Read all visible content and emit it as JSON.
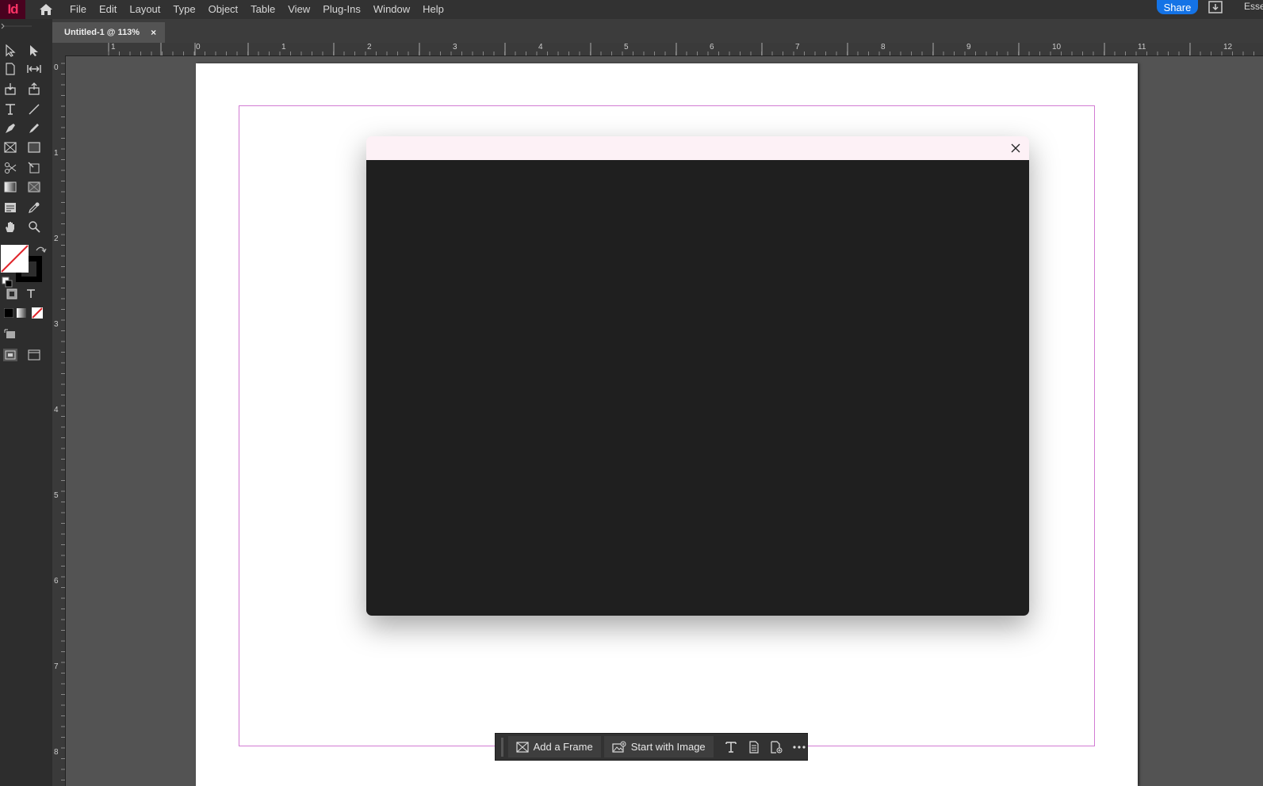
{
  "app": {
    "logo_text": "Id",
    "menu": [
      "File",
      "Edit",
      "Layout",
      "Type",
      "Object",
      "Table",
      "View",
      "Plug-Ins",
      "Window",
      "Help"
    ],
    "share_label": "Share",
    "workspace_label": "Esse"
  },
  "document": {
    "tab_title": "Untitled-1 @ 113%",
    "tab_close": "×"
  },
  "rulers": {
    "horizontal_labels": [
      "1",
      "0",
      "1",
      "2",
      "3",
      "4",
      "5",
      "6",
      "7",
      "8",
      "9",
      "10",
      "11",
      "12"
    ],
    "vertical_labels": [
      "0",
      "1",
      "2",
      "3",
      "4",
      "5",
      "6",
      "7",
      "8"
    ]
  },
  "tools": [
    "selection-tool-icon",
    "direct-selection-tool-icon",
    "page-tool-icon",
    "gap-tool-icon",
    "content-collector-icon",
    "content-placer-icon",
    "type-tool-icon",
    "line-tool-icon",
    "pen-tool-icon",
    "pencil-tool-icon",
    "rectangle-frame-tool-icon",
    "rectangle-tool-icon",
    "scissors-tool-icon",
    "free-transform-tool-icon",
    "gradient-swatch-tool-icon",
    "gradient-feather-tool-icon",
    "note-tool-icon",
    "eyedropper-tool-icon",
    "hand-tool-icon",
    "zoom-tool-icon"
  ],
  "taskbar": {
    "add_frame_label": "Add a Frame",
    "start_image_label": "Start with Image",
    "icons": [
      "text-icon",
      "page-icon",
      "place-icon",
      "more-icon"
    ]
  },
  "colors": {
    "accent": "#1473e6",
    "logo_bg": "#49021f",
    "logo_fg": "#ff3366",
    "margin_guide": "#d27bd3",
    "dialog_header": "#fdf1f6",
    "dialog_body": "#1f1f1f"
  }
}
